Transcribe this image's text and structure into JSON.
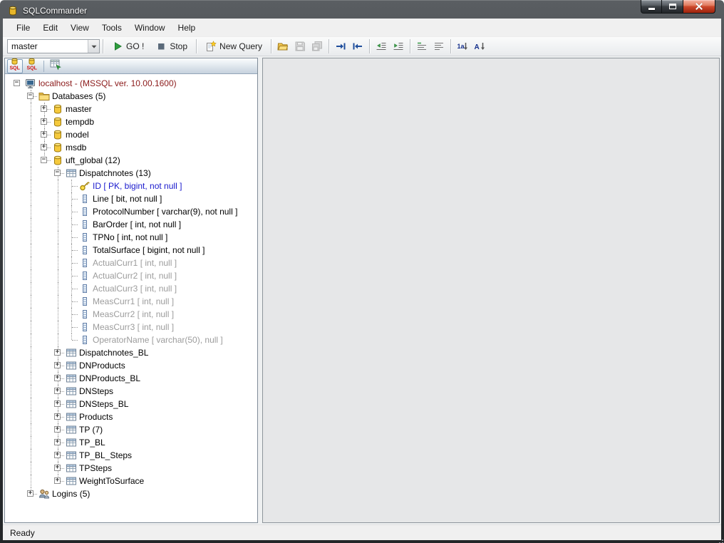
{
  "window": {
    "title": "SQLCommander",
    "status": "Ready"
  },
  "menubar": {
    "items": [
      "File",
      "Edit",
      "View",
      "Tools",
      "Window",
      "Help"
    ]
  },
  "toolbar": {
    "database_dropdown": "master",
    "go_label": "GO !",
    "stop_label": "Stop",
    "new_query_label": "New Query",
    "icons": [
      {
        "name": "open-file-icon",
        "enabled": true
      },
      {
        "name": "save-icon",
        "enabled": false
      },
      {
        "name": "save-all-icon",
        "enabled": false
      },
      {
        "separator": true
      },
      {
        "name": "goto-next-icon",
        "enabled": true
      },
      {
        "name": "goto-previous-icon",
        "enabled": true
      },
      {
        "separator": true
      },
      {
        "name": "decrease-indent-icon",
        "enabled": true
      },
      {
        "name": "increase-indent-icon",
        "enabled": true
      },
      {
        "separator": true
      },
      {
        "name": "comment-lines-icon",
        "enabled": true
      },
      {
        "name": "uncomment-lines-icon",
        "enabled": true
      },
      {
        "separator": true
      },
      {
        "name": "make-lowercase-icon",
        "enabled": true
      },
      {
        "name": "make-uppercase-icon",
        "enabled": true
      }
    ]
  },
  "explorer_tabs": [
    {
      "name": "tab-sql-connection-1",
      "icon": "sql-database-icon",
      "active": true
    },
    {
      "name": "tab-sql-connection-2",
      "icon": "sql-database-icon",
      "active": false
    },
    {
      "separator": true
    },
    {
      "name": "tab-table-browser",
      "icon": "table-data-icon",
      "active": false
    }
  ],
  "tree": {
    "items": [
      {
        "label": "localhost - (MSSQL ver. 10.00.1600)",
        "depth": 0,
        "icon": "server-icon",
        "expander": "minus",
        "style": "server"
      },
      {
        "label": "Databases (5)",
        "depth": 1,
        "icon": "folder-icon",
        "expander": "minus",
        "style": "normal"
      },
      {
        "label": "master",
        "depth": 2,
        "icon": "database-icon",
        "expander": "plus",
        "style": "normal"
      },
      {
        "label": "tempdb",
        "depth": 2,
        "icon": "database-icon",
        "expander": "plus",
        "style": "normal"
      },
      {
        "label": "model",
        "depth": 2,
        "icon": "database-icon",
        "expander": "plus",
        "style": "normal"
      },
      {
        "label": "msdb",
        "depth": 2,
        "icon": "database-icon",
        "expander": "plus",
        "style": "normal"
      },
      {
        "label": "uft_global (12)",
        "depth": 2,
        "icon": "database-icon",
        "expander": "minus",
        "style": "normal"
      },
      {
        "label": "Dispatchnotes (13)",
        "depth": 3,
        "icon": "table-icon",
        "expander": "minus",
        "style": "normal"
      },
      {
        "label": "ID [ PK, bigint, not null ]",
        "depth": 4,
        "icon": "key-icon",
        "expander": "none",
        "style": "pk"
      },
      {
        "label": "Line [ bit, not null ]",
        "depth": 4,
        "icon": "column-icon",
        "expander": "none",
        "style": "normal"
      },
      {
        "label": "ProtocolNumber [ varchar(9), not null ]",
        "depth": 4,
        "icon": "column-icon",
        "expander": "none",
        "style": "normal"
      },
      {
        "label": "BarOrder [ int, not null ]",
        "depth": 4,
        "icon": "column-icon",
        "expander": "none",
        "style": "normal"
      },
      {
        "label": "TPNo [ int, not null ]",
        "depth": 4,
        "icon": "column-icon",
        "expander": "none",
        "style": "normal"
      },
      {
        "label": "TotalSurface [ bigint, not null ]",
        "depth": 4,
        "icon": "column-icon",
        "expander": "none",
        "style": "normal"
      },
      {
        "label": "ActualCurr1 [ int, null ]",
        "depth": 4,
        "icon": "column-icon",
        "expander": "none",
        "style": "nullable"
      },
      {
        "label": "ActualCurr2 [ int, null ]",
        "depth": 4,
        "icon": "column-icon",
        "expander": "none",
        "style": "nullable"
      },
      {
        "label": "ActualCurr3 [ int, null ]",
        "depth": 4,
        "icon": "column-icon",
        "expander": "none",
        "style": "nullable"
      },
      {
        "label": "MeasCurr1 [ int, null ]",
        "depth": 4,
        "icon": "column-icon",
        "expander": "none",
        "style": "nullable"
      },
      {
        "label": "MeasCurr2 [ int, null ]",
        "depth": 4,
        "icon": "column-icon",
        "expander": "none",
        "style": "nullable"
      },
      {
        "label": "MeasCurr3 [ int, null ]",
        "depth": 4,
        "icon": "column-icon",
        "expander": "none",
        "style": "nullable"
      },
      {
        "label": "OperatorName [ varchar(50), null ]",
        "depth": 4,
        "icon": "column-icon",
        "expander": "none",
        "style": "nullable"
      },
      {
        "label": "Dispatchnotes_BL",
        "depth": 3,
        "icon": "table-icon",
        "expander": "plus",
        "style": "normal"
      },
      {
        "label": "DNProducts",
        "depth": 3,
        "icon": "table-icon",
        "expander": "plus",
        "style": "normal"
      },
      {
        "label": "DNProducts_BL",
        "depth": 3,
        "icon": "table-icon",
        "expander": "plus",
        "style": "normal"
      },
      {
        "label": "DNSteps",
        "depth": 3,
        "icon": "table-icon",
        "expander": "plus",
        "style": "normal"
      },
      {
        "label": "DNSteps_BL",
        "depth": 3,
        "icon": "table-icon",
        "expander": "plus",
        "style": "normal"
      },
      {
        "label": "Products",
        "depth": 3,
        "icon": "table-icon",
        "expander": "plus",
        "style": "normal"
      },
      {
        "label": "TP (7)",
        "depth": 3,
        "icon": "table-icon",
        "expander": "plus",
        "style": "normal"
      },
      {
        "label": "TP_BL",
        "depth": 3,
        "icon": "table-icon",
        "expander": "plus",
        "style": "normal"
      },
      {
        "label": "TP_BL_Steps",
        "depth": 3,
        "icon": "table-icon",
        "expander": "plus",
        "style": "normal"
      },
      {
        "label": "TPSteps",
        "depth": 3,
        "icon": "table-icon",
        "expander": "plus",
        "style": "normal"
      },
      {
        "label": "WeightToSurface",
        "depth": 3,
        "icon": "table-icon",
        "expander": "plus",
        "style": "normal"
      },
      {
        "label": "Logins (5)",
        "depth": 1,
        "icon": "logins-icon",
        "expander": "plus",
        "style": "normal"
      }
    ]
  }
}
